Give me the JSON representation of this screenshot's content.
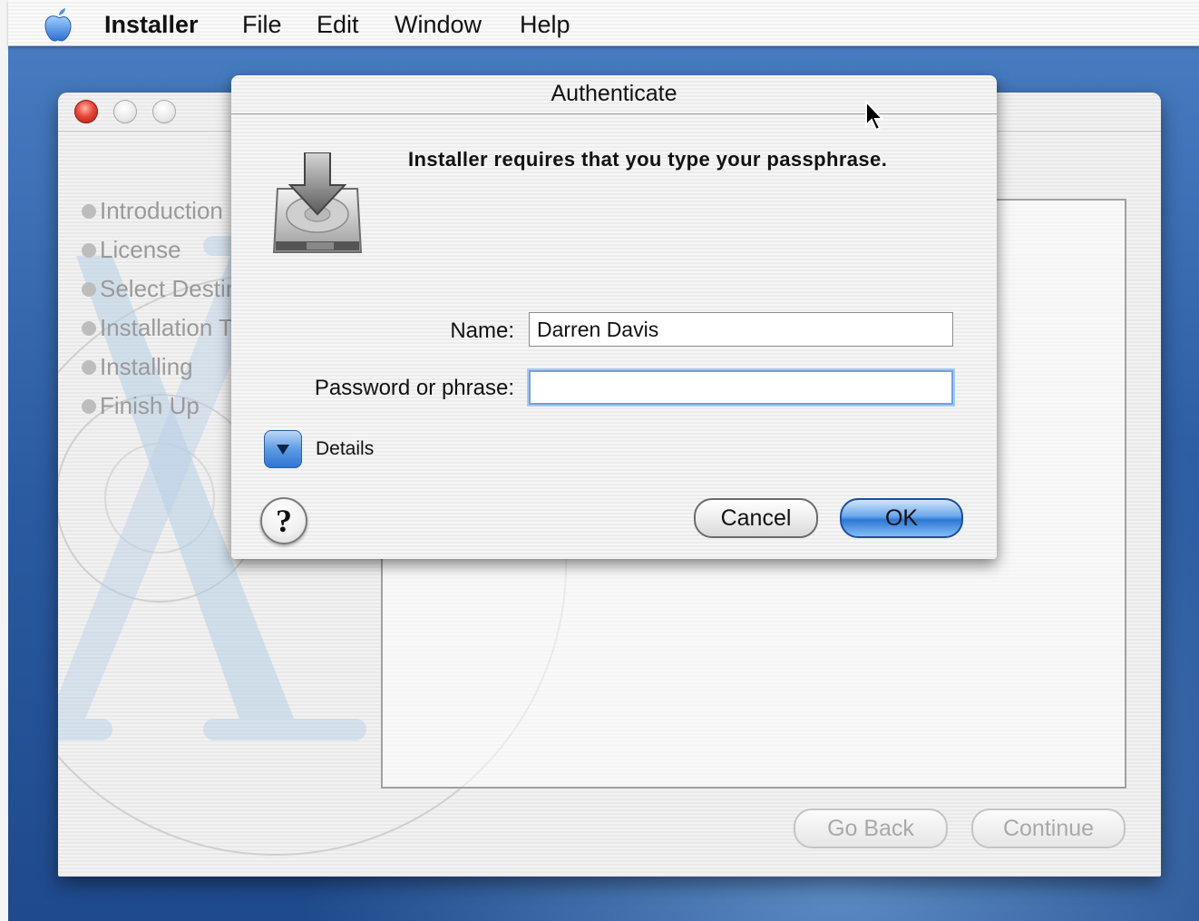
{
  "menubar": {
    "app_name": "Installer",
    "items": [
      "File",
      "Edit",
      "Window",
      "Help"
    ]
  },
  "installer_window": {
    "steps": [
      "Introduction",
      "License",
      "Select Destination",
      "Installation Type",
      "Installing",
      "Finish Up"
    ],
    "go_back_label": "Go Back",
    "continue_label": "Continue"
  },
  "auth_sheet": {
    "title": "Authenticate",
    "prompt": "Installer requires that you type your passphrase.",
    "name_label": "Name:",
    "name_value": "Darren Davis",
    "password_label": "Password or phrase:",
    "password_value": "",
    "details_label": "Details",
    "help_label": "?",
    "cancel_label": "Cancel",
    "ok_label": "OK"
  },
  "icons": {
    "apple": "apple-menu-icon",
    "installer_disk": "installer-disk-icon",
    "cursor": "mouse-pointer-icon"
  },
  "colors": {
    "desktop": "#2f5f9e",
    "default_button": "#2c77d8",
    "close_button": "#e8463a"
  }
}
